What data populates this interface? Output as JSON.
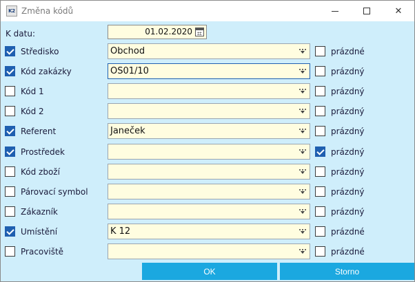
{
  "window": {
    "app_icon_text": "K2",
    "title": "Změna kódů"
  },
  "date": {
    "label": "K datu:",
    "value": "01.02.2020"
  },
  "rows": [
    {
      "label": "Středisko",
      "checked": true,
      "value": "Obchod",
      "right_label": "prázdné",
      "right_checked": false,
      "focused": false
    },
    {
      "label": "Kód zakázky",
      "checked": true,
      "value": "OS01/10",
      "right_label": "prázdný",
      "right_checked": false,
      "focused": true
    },
    {
      "label": "Kód 1",
      "checked": false,
      "value": "",
      "right_label": "prázdný",
      "right_checked": false,
      "focused": false
    },
    {
      "label": "Kód 2",
      "checked": false,
      "value": "",
      "right_label": "prázdný",
      "right_checked": false,
      "focused": false
    },
    {
      "label": "Referent",
      "checked": true,
      "value": "Janeček",
      "right_label": "prázdný",
      "right_checked": false,
      "focused": false
    },
    {
      "label": "Prostředek",
      "checked": true,
      "value": "",
      "right_label": "prázdný",
      "right_checked": true,
      "focused": false
    },
    {
      "label": "Kód zboží",
      "checked": false,
      "value": "",
      "right_label": "prázdný",
      "right_checked": false,
      "focused": false
    },
    {
      "label": "Párovací symbol",
      "checked": false,
      "value": "",
      "right_label": "prázdný",
      "right_checked": false,
      "focused": false
    },
    {
      "label": "Zákazník",
      "checked": false,
      "value": "",
      "right_label": "prázdný",
      "right_checked": false,
      "focused": false
    },
    {
      "label": "Umístění",
      "checked": true,
      "value": "K 12",
      "right_label": "prázdné",
      "right_checked": false,
      "focused": false
    },
    {
      "label": "Pracoviště",
      "checked": false,
      "value": "",
      "right_label": "prázdné",
      "right_checked": false,
      "focused": false
    }
  ],
  "buttons": {
    "ok_label": "OK",
    "cancel_label": "Storno"
  },
  "colors": {
    "dialog_background": "#cfeefb",
    "field_background": "#fffde0",
    "checkbox_checked": "#1f5fb0",
    "button_background": "#1ba8e0"
  }
}
